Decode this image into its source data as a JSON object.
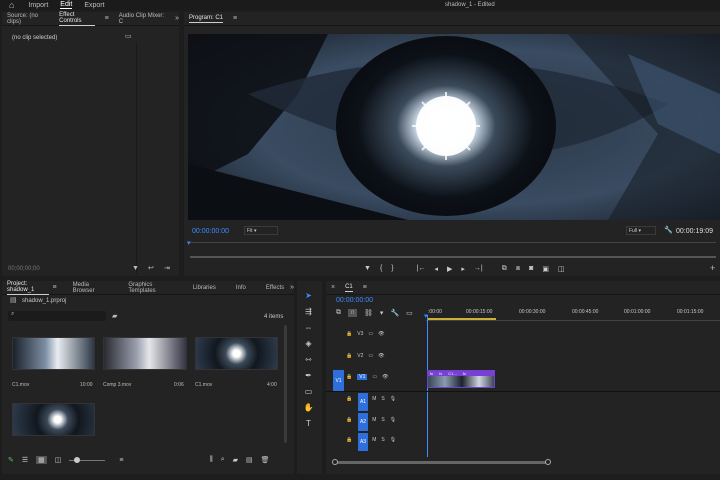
{
  "menu": {
    "home_icon": "home-icon",
    "items": [
      "Import",
      "Edit",
      "Export"
    ],
    "active": "Edit",
    "title": "shadow_1 - Edited"
  },
  "source_panel": {
    "tabs": [
      "Source: (no clips)",
      "Effect Controls",
      "Audio Clip Mixer: C"
    ],
    "no_clip": "(no clip selected)",
    "timecode": "00;00;00;00"
  },
  "program": {
    "tab": "Program: C1",
    "timecode": "00:00:00:00",
    "fit": "Fit",
    "quality": "Full",
    "duration": "00:00:19:09"
  },
  "project": {
    "tabs": [
      "Project: shadow_1",
      "Media Browser",
      "Graphics Templates",
      "Libraries",
      "Info",
      "Effects"
    ],
    "file": "shadow_1.prproj",
    "items_count": "4 items",
    "items": [
      {
        "name": "C1.mov",
        "duration": "10:00"
      },
      {
        "name": "Comp 3.mov",
        "duration": "0:06"
      },
      {
        "name": "C1.mov",
        "duration": "4:00"
      },
      {
        "name": "",
        "duration": ""
      }
    ]
  },
  "timeline": {
    "tab": "C1",
    "timecode": "00:00:00:00",
    "ruler": [
      ":00:00",
      "00:00:15:00",
      "00:00:30:00",
      "00:00:45:00",
      "00:01:00:00",
      "00:01:15:00"
    ],
    "video_tracks": [
      "V3",
      "V2",
      "V1"
    ],
    "audio_tracks": [
      "A1",
      "A2",
      "A3"
    ],
    "src_v": "V1",
    "src_a": [
      "A1",
      "A2",
      "A3"
    ],
    "clip_labels": [
      "fx",
      "fx",
      "C1...",
      "fx"
    ]
  },
  "colors": {
    "accent": "#2d8ceb",
    "clip_purple": "#7a3fd6",
    "clip_blue": "#2e6fdc"
  }
}
